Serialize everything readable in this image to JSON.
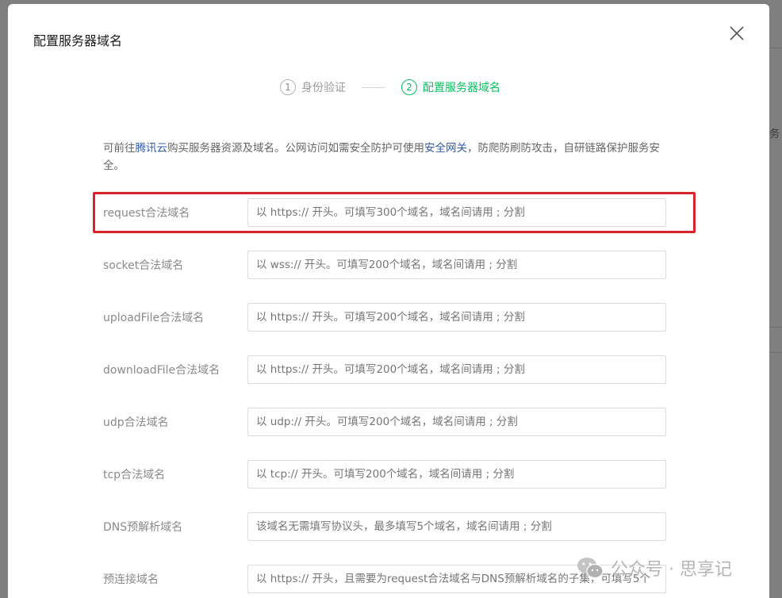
{
  "dialog": {
    "title": "配置服务器域名",
    "close_icon": "close-icon"
  },
  "steps": [
    {
      "num": "1",
      "label": "身份验证",
      "active": false
    },
    {
      "num": "2",
      "label": "配置服务器域名",
      "active": true
    }
  ],
  "description": {
    "part1": "可前往",
    "link1": "腾讯云",
    "part2": "购买服务器资源及域名。公网访问如需安全防护可使用",
    "link2": "安全网关",
    "part3": "，防爬防刷防攻击，自研链路保护服务安全。"
  },
  "fields": [
    {
      "label": "request合法域名",
      "placeholder": "以 https:// 开头。可填写300个域名，域名间请用 ; 分割"
    },
    {
      "label": "socket合法域名",
      "placeholder": "以 wss:// 开头。可填写200个域名，域名间请用 ; 分割"
    },
    {
      "label": "uploadFile合法域名",
      "placeholder": "以 https:// 开头。可填写200个域名，域名间请用 ; 分割"
    },
    {
      "label": "downloadFile合法域名",
      "placeholder": "以 https:// 开头。可填写200个域名，域名间请用 ; 分割"
    },
    {
      "label": "udp合法域名",
      "placeholder": "以 udp:// 开头。可填写200个域名，域名间请用 ; 分割"
    },
    {
      "label": "tcp合法域名",
      "placeholder": "以 tcp:// 开头。可填写200个域名，域名间请用 ; 分割"
    },
    {
      "label": "DNS预解析域名",
      "placeholder": "该域名无需填写协议头，最多填写5个域名，域名间请用 ; 分割"
    },
    {
      "label": "预连接域名",
      "placeholder": "以 https:// 开头，且需要为request合法域名与DNS预解析域名的子集，可填写5个"
    }
  ],
  "background": {
    "edge_text": "务"
  },
  "watermark": {
    "text": "公众号 · 思享记",
    "icon": "wechat-icon"
  },
  "colors": {
    "accent": "#07c160",
    "link": "#2f5ba8",
    "highlight": "#d9232a"
  }
}
